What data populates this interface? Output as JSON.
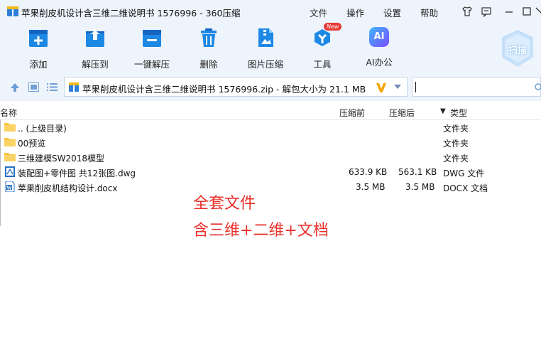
{
  "window": {
    "title": "苹果削皮机设计含三维二维说明书 1576996 - 360压缩",
    "menus": [
      "文件",
      "操作",
      "设置",
      "帮助"
    ]
  },
  "toolbar": {
    "items": [
      {
        "label": "添加",
        "icon": "add-box-icon"
      },
      {
        "label": "解压到",
        "icon": "extract-to-icon"
      },
      {
        "label": "一键解压",
        "icon": "one-click-extract-icon"
      },
      {
        "label": "删除",
        "icon": "trash-icon"
      },
      {
        "label": "图片压缩",
        "icon": "image-compress-icon"
      },
      {
        "label": "工具",
        "icon": "tools-icon",
        "badge": "New"
      },
      {
        "label": "AI办公",
        "icon": "ai-office-icon",
        "icon_text": "AI"
      }
    ],
    "scan_label": "扫描"
  },
  "address": {
    "path": "苹果削皮机设计含三维二维说明书 1576996.zip - 解包大小为 21.1 MB",
    "search_value": ""
  },
  "columns": {
    "name": "名称",
    "compressed_before": "压缩前",
    "compressed_after": "压缩后",
    "type": "类型",
    "sort_indicator": "▼"
  },
  "files": [
    {
      "name": ".. (上级目录)",
      "before": "",
      "after": "",
      "type": "文件夹",
      "icon": "folder-icon"
    },
    {
      "name": "00预览",
      "before": "",
      "after": "",
      "type": "文件夹",
      "icon": "folder-icon"
    },
    {
      "name": "三维建模SW2018模型",
      "before": "",
      "after": "",
      "type": "文件夹",
      "icon": "folder-icon"
    },
    {
      "name": "装配图+零件图 共12张图.dwg",
      "before": "633.9 KB",
      "after": "563.1 KB",
      "type": "DWG 文件",
      "icon": "dwg-file-icon"
    },
    {
      "name": "苹果削皮机结构设计.docx",
      "before": "3.5 MB",
      "after": "3.5 MB",
      "type": "DOCX 文档",
      "icon": "docx-file-icon"
    }
  ],
  "overlay": {
    "line1": "全套文件",
    "line2": "含三维+二维+文档"
  },
  "colors": {
    "chrome_bg": "#eef4fc",
    "icon_blue": "#1e88e5",
    "overlay_red": "#e8312b",
    "badge_red": "#e53935",
    "folder_yellow": "#f7c443"
  }
}
